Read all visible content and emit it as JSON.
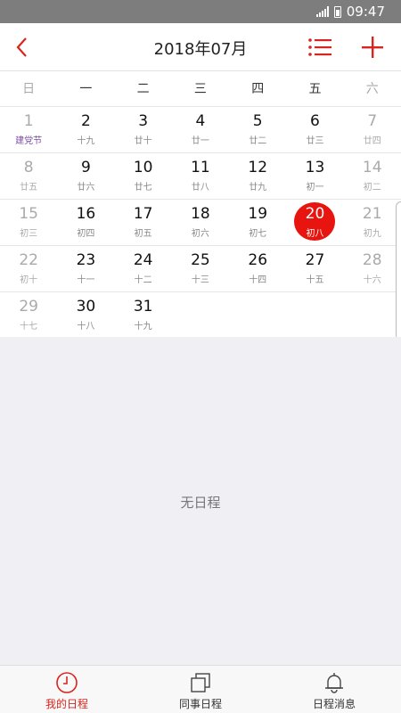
{
  "status_bar": {
    "time": "09:47",
    "icons": [
      "signal-icon",
      "battery-icon"
    ]
  },
  "header": {
    "title": "2018年07月",
    "icons": [
      "chevron-left-icon",
      "list-icon",
      "plus-icon"
    ],
    "accent_color": "#d8261e"
  },
  "weekdays": [
    "日",
    "一",
    "二",
    "三",
    "四",
    "五",
    "六"
  ],
  "calendar": {
    "selected_day": "20",
    "rows": [
      [
        {
          "num": "1",
          "lunar": "建党节",
          "dim": true,
          "holiday": true
        },
        {
          "num": "2",
          "lunar": "十九"
        },
        {
          "num": "3",
          "lunar": "廿十"
        },
        {
          "num": "4",
          "lunar": "廿一"
        },
        {
          "num": "5",
          "lunar": "廿二"
        },
        {
          "num": "6",
          "lunar": "廿三"
        },
        {
          "num": "7",
          "lunar": "廿四",
          "dim": true
        }
      ],
      [
        {
          "num": "8",
          "lunar": "廿五",
          "dim": true
        },
        {
          "num": "9",
          "lunar": "廿六"
        },
        {
          "num": "10",
          "lunar": "廿七"
        },
        {
          "num": "11",
          "lunar": "廿八"
        },
        {
          "num": "12",
          "lunar": "廿九"
        },
        {
          "num": "13",
          "lunar": "初一"
        },
        {
          "num": "14",
          "lunar": "初二",
          "dim": true
        }
      ],
      [
        {
          "num": "15",
          "lunar": "初三",
          "dim": true
        },
        {
          "num": "16",
          "lunar": "初四"
        },
        {
          "num": "17",
          "lunar": "初五"
        },
        {
          "num": "18",
          "lunar": "初六"
        },
        {
          "num": "19",
          "lunar": "初七"
        },
        {
          "num": "20",
          "lunar": "初八",
          "selected": true
        },
        {
          "num": "21",
          "lunar": "初九",
          "dim": true
        }
      ],
      [
        {
          "num": "22",
          "lunar": "初十",
          "dim": true
        },
        {
          "num": "23",
          "lunar": "十一"
        },
        {
          "num": "24",
          "lunar": "十二"
        },
        {
          "num": "25",
          "lunar": "十三"
        },
        {
          "num": "26",
          "lunar": "十四"
        },
        {
          "num": "27",
          "lunar": "十五"
        },
        {
          "num": "28",
          "lunar": "十六",
          "dim": true
        }
      ],
      [
        {
          "num": "29",
          "lunar": "十七",
          "dim": true
        },
        {
          "num": "30",
          "lunar": "十八"
        },
        {
          "num": "31",
          "lunar": "十九"
        }
      ]
    ]
  },
  "empty_message": "无日程",
  "bottom_nav": {
    "tabs": [
      {
        "label": "我的日程",
        "icon": "clock-icon",
        "active": true
      },
      {
        "label": "同事日程",
        "icon": "copy-icon",
        "active": false
      },
      {
        "label": "日程消息",
        "icon": "bell-icon",
        "active": false
      }
    ]
  }
}
